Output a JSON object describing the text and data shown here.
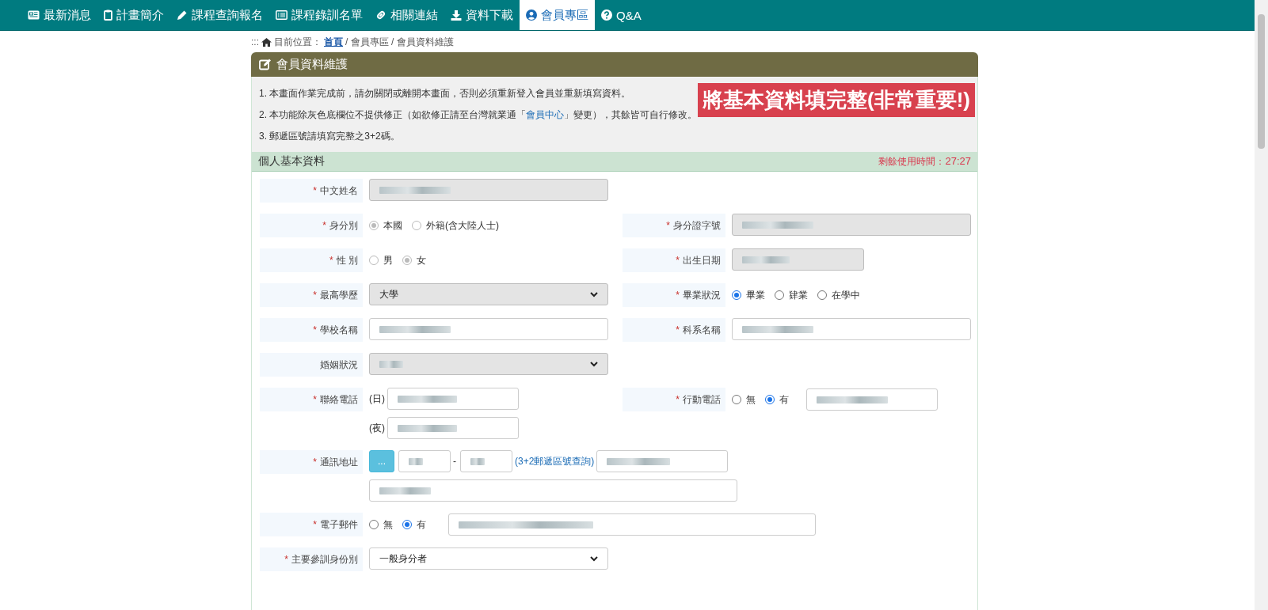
{
  "nav": [
    {
      "label": "最新消息",
      "selected": false
    },
    {
      "label": "計畫簡介",
      "selected": false
    },
    {
      "label": "課程查詢報名",
      "selected": false
    },
    {
      "label": "課程錄訓名單",
      "selected": false
    },
    {
      "label": "相關連結",
      "selected": false
    },
    {
      "label": "資料下載",
      "selected": false
    },
    {
      "label": "會員專區",
      "selected": true
    },
    {
      "label": "Q&A",
      "selected": false
    }
  ],
  "breadcrumb": {
    "prefix": ":::",
    "label": "目前位置：",
    "link": "首頁",
    "trail": " / 會員專區 / 會員資料維護"
  },
  "panel": {
    "title": "會員資料維護",
    "notes": [
      {
        "parts": [
          {
            "text": "1. 本畫面作業完成前，請勿關閉或離開本畫面，否則必須重新登入會員並重新填寫資料。",
            "link": false
          }
        ]
      },
      {
        "parts": [
          {
            "text": "2. 本功能除灰色底欄位不提供修正（如欲修正請至台灣就業通「",
            "link": false
          },
          {
            "text": "會員中心",
            "link": true
          },
          {
            "text": "」變更），其餘皆可自行修改。",
            "link": false
          }
        ]
      },
      {
        "parts": [
          {
            "text": "3. 郵遞區號請填寫完整之3+2碼。",
            "link": false
          }
        ]
      }
    ],
    "banner": "將基本資料填完整(非常重要!)",
    "section": {
      "title": "個人基本資料",
      "timer_label": "剩餘使用時間：",
      "timer_value": "27:27"
    },
    "rows": [
      {
        "left": {
          "label": "中文姓名",
          "required_marker": "*",
          "kind": "text",
          "disabled": true
        },
        "right": null
      },
      {
        "left": {
          "label": "身分別",
          "required_marker": "*",
          "kind": "radio",
          "disabled": true,
          "options": [
            {
              "label": "本國",
              "selected": true
            },
            {
              "label": "外籍(含大陸人士)",
              "selected": false
            }
          ]
        },
        "right": {
          "label": "身分證字號",
          "required_marker": "*",
          "kind": "text",
          "disabled": true
        }
      },
      {
        "left": {
          "label": "性 別",
          "required_marker": "*",
          "kind": "radio",
          "disabled": true,
          "options": [
            {
              "label": "男",
              "selected": false
            },
            {
              "label": "女",
              "selected": true
            }
          ]
        },
        "right": {
          "label": "出生日期",
          "required_marker": "*",
          "kind": "date",
          "disabled": true
        }
      },
      {
        "left": {
          "label": "最高學歷",
          "required_marker": "*",
          "kind": "select",
          "disabled": true,
          "value": "大學"
        },
        "right": {
          "label": "畢業狀況",
          "required_marker": "*",
          "kind": "radio",
          "disabled": false,
          "options": [
            {
              "label": "畢業",
              "selected": true
            },
            {
              "label": "肄業",
              "selected": false
            },
            {
              "label": "在學中",
              "selected": false
            }
          ]
        }
      },
      {
        "left": {
          "label": "學校名稱",
          "required_marker": "*",
          "kind": "text",
          "disabled": false
        },
        "right": {
          "label": "科系名稱",
          "required_marker": "*",
          "kind": "text",
          "disabled": false
        }
      },
      {
        "left": {
          "label": "婚姻狀況",
          "kind": "select",
          "disabled": true
        },
        "right": null
      },
      {
        "left": {
          "label": "聯絡電話",
          "required_marker": "*",
          "kind": "phone",
          "prefixes": [
            "(日)",
            "(夜)"
          ]
        },
        "right": {
          "label": "行動電話",
          "required_marker": "*",
          "kind": "radio-input",
          "disabled": false,
          "options": [
            {
              "label": "無",
              "selected": false
            },
            {
              "label": "有",
              "selected": true
            }
          ]
        }
      },
      {
        "left": {
          "label": "通訊地址",
          "required_marker": "*",
          "kind": "address",
          "button": "...",
          "separator": "-",
          "link": "(3+2郵遞區號查詢)"
        },
        "right": null
      },
      {
        "left": {
          "label": "電子郵件",
          "required_marker": "*",
          "kind": "radio-input",
          "disabled": false,
          "options": [
            {
              "label": "無",
              "selected": false
            },
            {
              "label": "有",
              "selected": true
            }
          ]
        },
        "right": null
      },
      {
        "left": {
          "label": "主要參訓身份別",
          "required_marker": "*",
          "kind": "select",
          "disabled": false,
          "value": "一般身分者"
        },
        "right": null
      }
    ]
  }
}
